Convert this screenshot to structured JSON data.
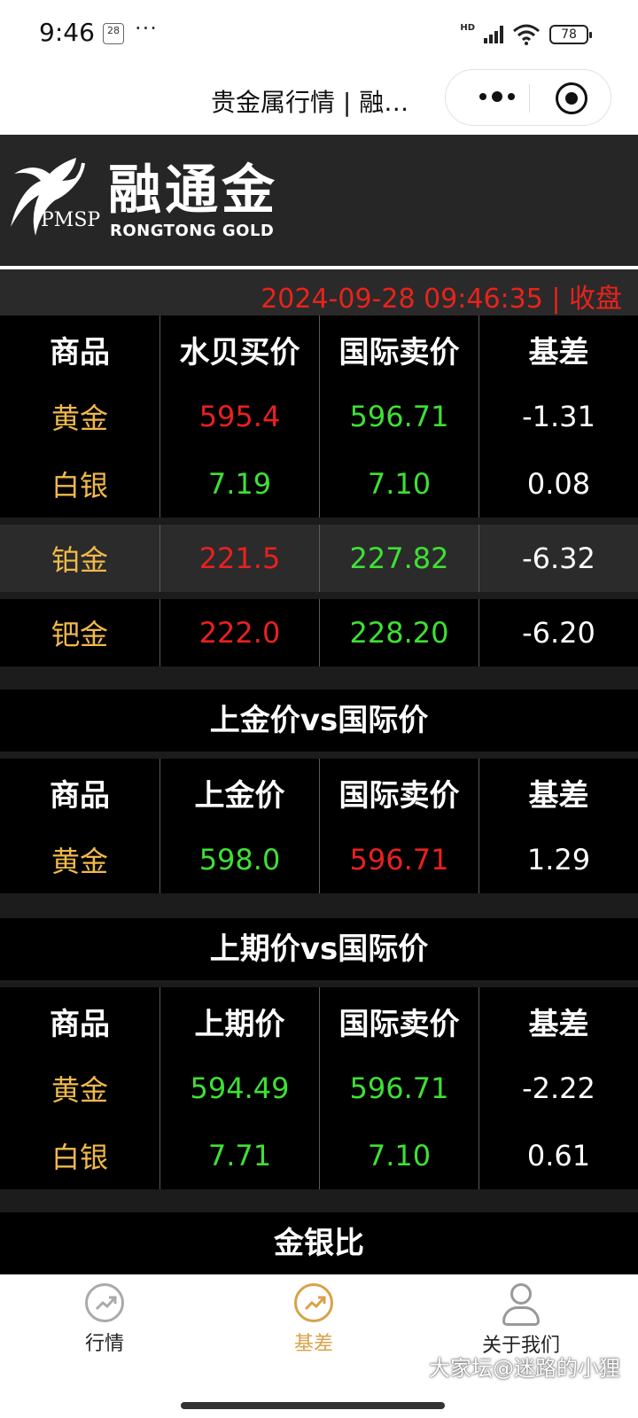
{
  "status_bar": {
    "time": "9:46",
    "date_icon": "28",
    "more": "···",
    "network": "HD",
    "battery": "78"
  },
  "titlebar": {
    "title": "贵金属行情 | 融…"
  },
  "brand": {
    "mark_text": "PMSP",
    "name_cn": "融通金",
    "name_en": "RONGTONG GOLD"
  },
  "timestamp": "2024-09-28 09:46:35 | 收盘",
  "table1": {
    "headers": [
      "商品",
      "水贝买价",
      "国际卖价",
      "基差"
    ],
    "rows": [
      [
        "黄金",
        "595.4",
        "596.71",
        "-1.31"
      ],
      [
        "白银",
        "7.19",
        "7.10",
        "0.08"
      ],
      [
        "铂金",
        "221.5",
        "227.82",
        "-6.32"
      ],
      [
        "钯金",
        "222.0",
        "228.20",
        "-6.20"
      ]
    ]
  },
  "section2": {
    "title": "上金价vs国际价",
    "headers": [
      "商品",
      "上金价",
      "国际卖价",
      "基差"
    ],
    "rows": [
      [
        "黄金",
        "598.0",
        "596.71",
        "1.29"
      ]
    ]
  },
  "section3": {
    "title": "上期价vs国际价",
    "headers": [
      "商品",
      "上期价",
      "国际卖价",
      "基差"
    ],
    "rows": [
      [
        "黄金",
        "594.49",
        "596.71",
        "-2.22"
      ],
      [
        "白银",
        "7.71",
        "7.10",
        "0.61"
      ]
    ]
  },
  "section4": {
    "title": "金银比"
  },
  "colors": {
    "gold": "#f0b94a",
    "red": "#ea2020",
    "green": "#3ee035",
    "accent": "#d8a24a"
  },
  "tabs": [
    {
      "label": "行情",
      "icon": "trend-chart-icon"
    },
    {
      "label": "基差",
      "icon": "trend-chart-icon",
      "active": true
    },
    {
      "label": "关于我们",
      "icon": "person-icon"
    }
  ],
  "watermark": "大家坛@迷路的小狸"
}
